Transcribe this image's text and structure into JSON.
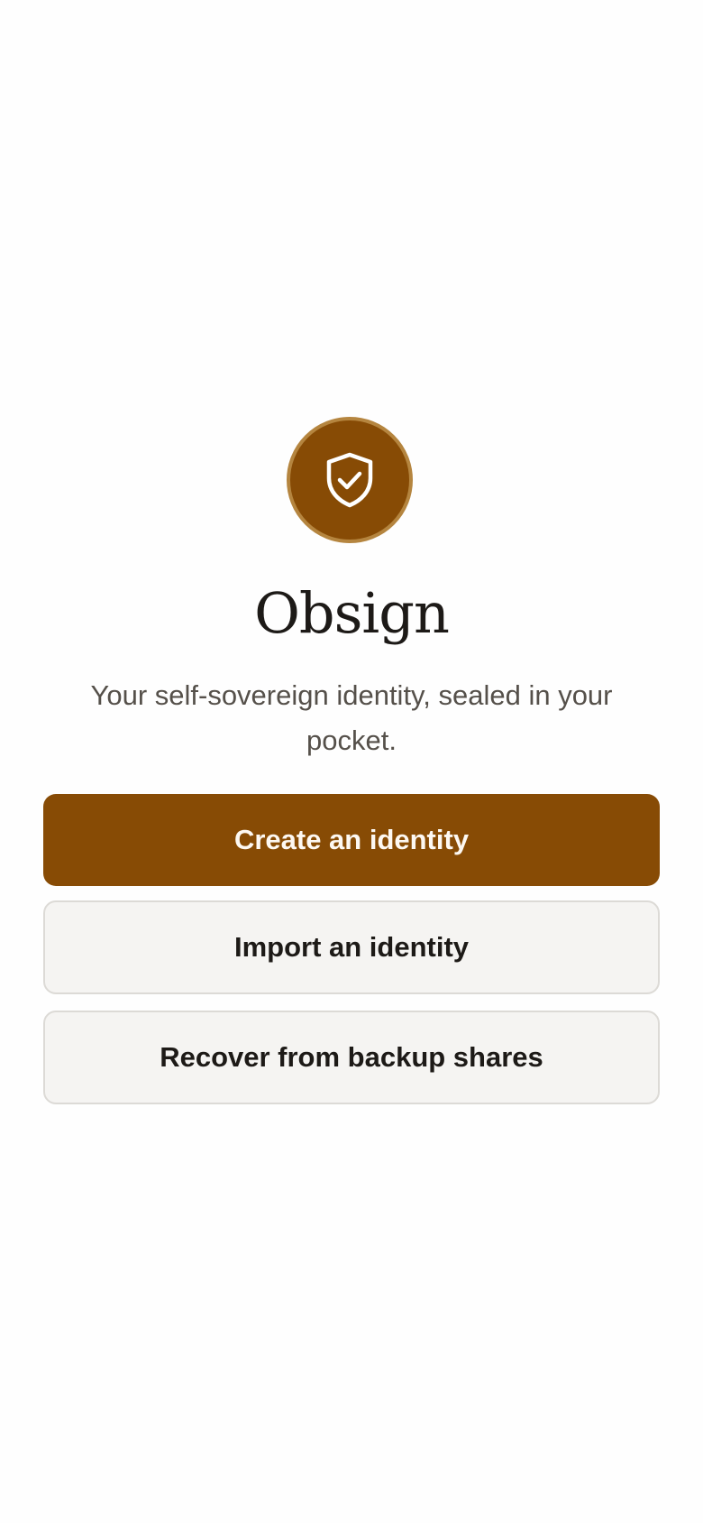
{
  "app": {
    "name": "Obsign",
    "tagline": "Your self-sovereign identity, sealed in your pocket.",
    "logo_icon": "shield-check-icon"
  },
  "actions": {
    "create_label": "Create an identity",
    "import_label": "Import an identity",
    "recover_label": "Recover from backup shares"
  },
  "colors": {
    "brand": "#874b05",
    "brand_ring": "#b5853f",
    "text_primary": "#1d1a17",
    "text_secondary": "#55504a",
    "secondary_button_bg": "#f5f4f2",
    "secondary_button_border": "#dcdad6"
  }
}
